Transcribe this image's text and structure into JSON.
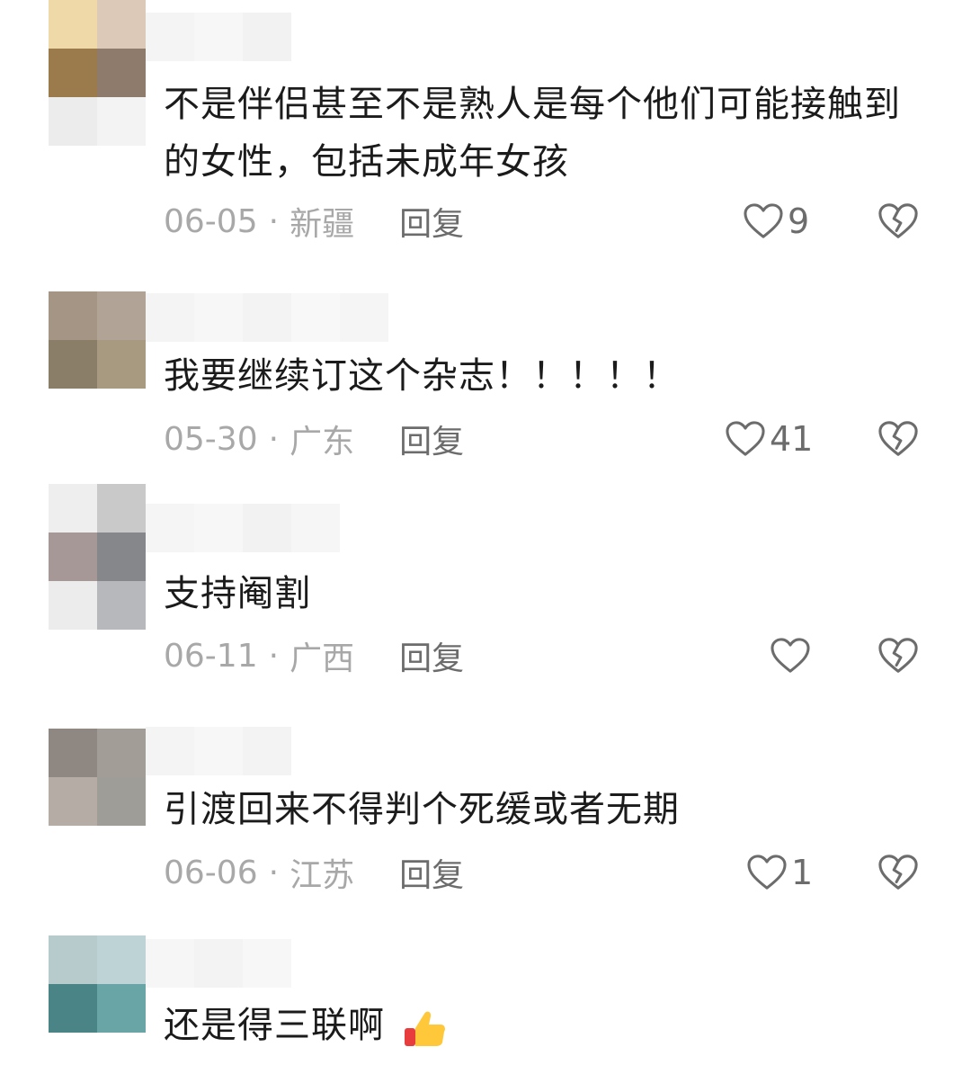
{
  "comments": [
    {
      "text": "不是伴侣甚至不是熟人是每个他们可能接触到的女性，包括未成年女孩",
      "date": "06-05",
      "location": "新疆",
      "reply_label": "回复",
      "likes": "9"
    },
    {
      "text": "我要继续订这个杂志！！！！！",
      "date": "05-30",
      "location": "广东",
      "reply_label": "回复",
      "likes": "41"
    },
    {
      "text": "支持阉割",
      "date": "06-11",
      "location": "广西",
      "reply_label": "回复",
      "likes": ""
    },
    {
      "text": "引渡回来不得判个死缓或者无期",
      "date": "06-06",
      "location": "江苏",
      "reply_label": "回复",
      "likes": "1"
    },
    {
      "text": "还是得三联啊",
      "date": "",
      "location": "",
      "reply_label": "",
      "likes": ""
    }
  ],
  "separator": "·",
  "icons": {
    "like": "heart-outline-icon",
    "dislike": "broken-heart-icon",
    "emoji": "thumbs-up-emoji-icon"
  },
  "colors": {
    "text": "#1b1b1b",
    "meta": "#a8a8a8",
    "action": "#6c6c6c"
  }
}
